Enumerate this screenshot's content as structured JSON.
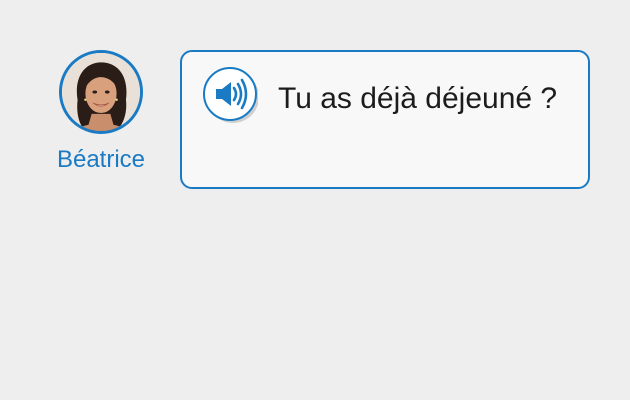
{
  "speaker": {
    "name": "Béatrice",
    "avatar_icon": "portrait-photo"
  },
  "bubble": {
    "audio_icon": "speaker-volume-icon",
    "sentence": "Tu as déjà déjeuné ?"
  },
  "colors": {
    "accent": "#1a7bc4",
    "background": "#eeeeee",
    "bubble_background": "#f8f8f8",
    "text": "#1c1c1c"
  }
}
